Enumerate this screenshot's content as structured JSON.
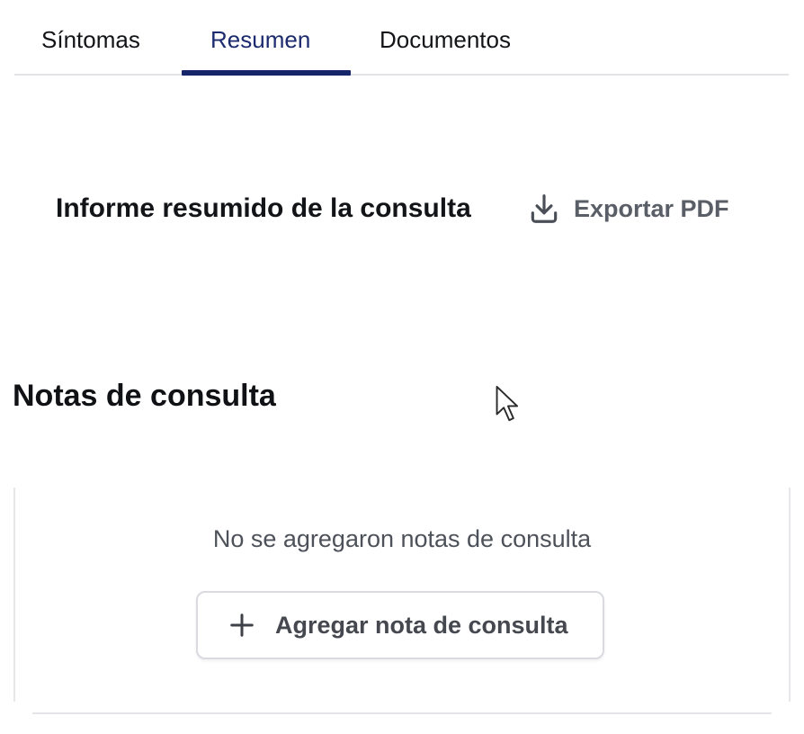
{
  "tabs": [
    {
      "label": "Síntomas",
      "active": false
    },
    {
      "label": "Resumen",
      "active": true
    },
    {
      "label": "Documentos",
      "active": false
    }
  ],
  "report": {
    "title": "Informe resumido de la consulta",
    "export_label": "Exportar PDF",
    "export_icon": "download-icon"
  },
  "notes": {
    "title": "Notas de consulta",
    "empty_message": "No se agregaron notas de consulta",
    "add_label": "Agregar nota de consulta",
    "add_icon": "plus-icon"
  },
  "colors": {
    "active_tab": "#16246a",
    "text": "#111318",
    "muted": "#5a5e66",
    "border": "#e2e3e7"
  }
}
